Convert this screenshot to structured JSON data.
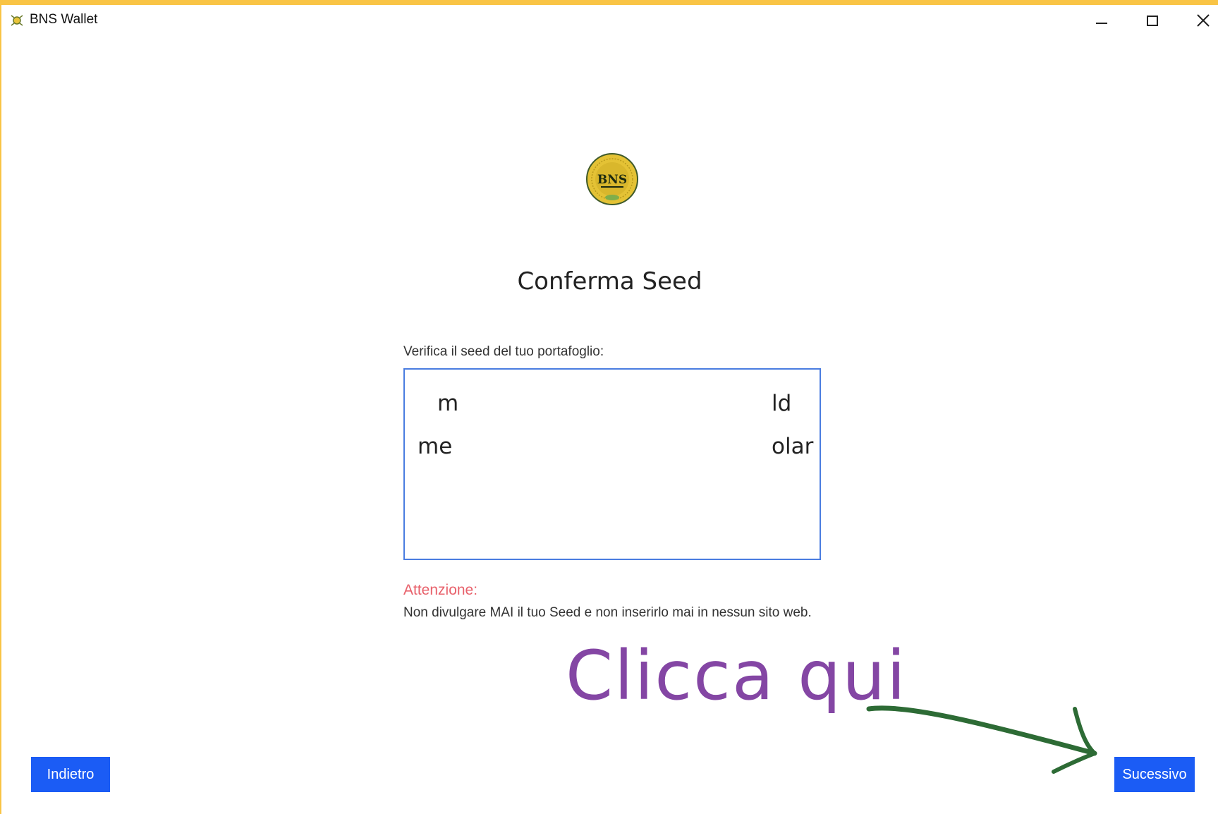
{
  "window": {
    "title": "BNS Wallet",
    "controls": [
      "minimize-icon",
      "maximize-icon",
      "close-icon"
    ]
  },
  "logo": {
    "text": "BNS"
  },
  "page": {
    "heading": "Conferma Seed",
    "seed_label": "Verifica il seed del tuo portafoglio:",
    "seed_words": [
      "m",
      "ld",
      "me",
      "olar"
    ],
    "warning_title": "Attenzione:",
    "warning_text": "Non divulgare MAI il tuo Seed e non inserirlo mai in nessun sito web."
  },
  "annotation": {
    "text": "Clicca qui"
  },
  "buttons": {
    "back": "Indietro",
    "next": "Sucessivo"
  },
  "colors": {
    "frame": "#f9c445",
    "accent": "#1b5cf5",
    "seed_border": "#4a7de0",
    "warning": "#e8616b",
    "annotation_text": "#8446a4",
    "annotation_arrow": "#2d6b35"
  }
}
